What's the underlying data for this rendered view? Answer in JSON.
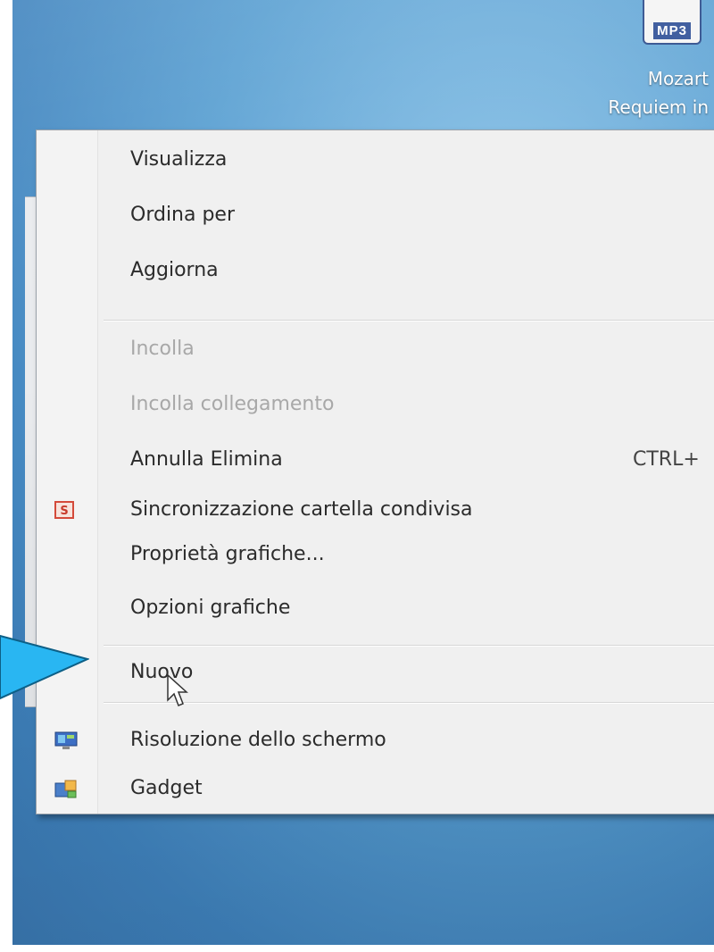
{
  "desktop": {
    "icon": {
      "name": "mp3-file-icon",
      "badge": "MP3",
      "caption_line1": "Mozart",
      "caption_line2": "Requiem in"
    }
  },
  "context_menu": {
    "items": [
      {
        "label": "Visualizza",
        "enabled": true
      },
      {
        "label": "Ordina per",
        "enabled": true
      },
      {
        "label": "Aggiorna",
        "enabled": true
      },
      {
        "label": "Incolla",
        "enabled": false
      },
      {
        "label": "Incolla collegamento",
        "enabled": false
      },
      {
        "label": "Annulla Elimina",
        "enabled": true,
        "shortcut": "CTRL+"
      },
      {
        "label": "Sincronizzazione cartella condivisa",
        "enabled": true,
        "icon": "sync-folder-icon"
      },
      {
        "label": "Proprietà grafiche...",
        "enabled": true
      },
      {
        "label": "Opzioni grafiche",
        "enabled": true
      },
      {
        "label": "Nuovo",
        "enabled": true,
        "hovered": true
      },
      {
        "label": "Risoluzione dello schermo",
        "enabled": true,
        "icon": "screen-resolution-icon"
      },
      {
        "label": "Gadget",
        "enabled": true,
        "icon": "gadget-icon"
      }
    ]
  },
  "colors": {
    "desktop_blue": "#4a8fc8",
    "menu_bg": "#f0f0f0",
    "arrow_fill": "#29b6f2",
    "text_enabled": "#2b2b2b",
    "text_disabled": "#a8a8a8"
  }
}
